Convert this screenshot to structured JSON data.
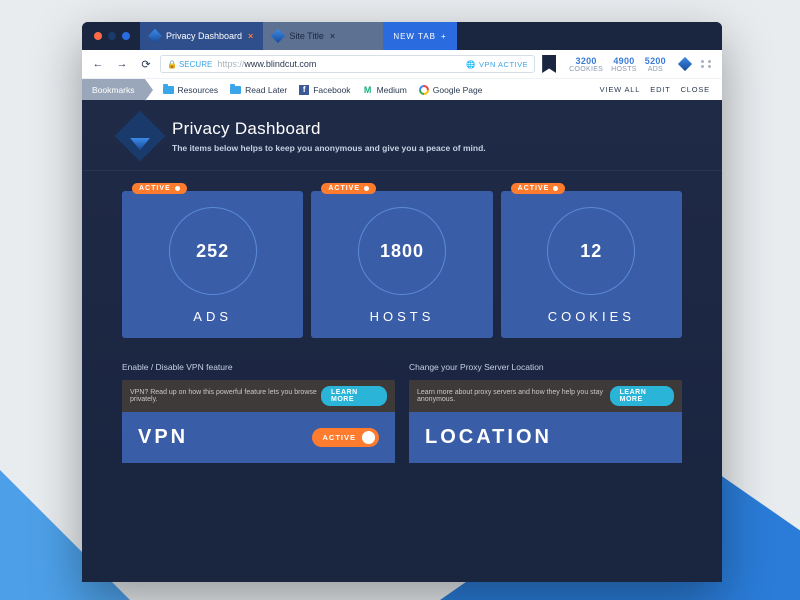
{
  "tabs": {
    "active": {
      "label": "Privacy Dashboard"
    },
    "inactive": {
      "label": "Site Title"
    },
    "newtab": "NEW TAB"
  },
  "addr": {
    "secure": "SECURE",
    "prefix": "https://",
    "domain": "www.blindcut.com",
    "vpn": "VPN ACTIVE"
  },
  "stats": {
    "cookies": {
      "n": "3200",
      "l": "COOKIES"
    },
    "hosts": {
      "n": "4900",
      "l": "HOSTS"
    },
    "ads": {
      "n": "5200",
      "l": "ADS"
    }
  },
  "bookmarks": {
    "label": "Bookmarks",
    "items": [
      "Resources",
      "Read Later",
      "Facebook",
      "Medium",
      "Google Page"
    ],
    "actions": [
      "VIEW ALL",
      "EDIT",
      "CLOSE"
    ]
  },
  "page": {
    "title": "Privacy Dashboard",
    "subtitle": "The items below helps to keep you anonymous and give you a peace of mind."
  },
  "cards": {
    "badge": "ACTIVE",
    "ads": {
      "n": "252",
      "l": "ADS"
    },
    "hosts": {
      "n": "1800",
      "l": "HOSTS"
    },
    "cookies": {
      "n": "12",
      "l": "COOKIES"
    }
  },
  "features": {
    "vpn": {
      "caption": "Enable / Disable VPN feature",
      "bar": "VPN? Read up on how this powerful feature lets you browse privately.",
      "learn": "LEARN MORE",
      "title": "VPN",
      "toggle": "ACTIVE"
    },
    "location": {
      "caption": "Change your Proxy Server Location",
      "bar": "Learn more about proxy servers and how they help you stay anonymous.",
      "learn": "LEARN MORE",
      "title": "LOCATION"
    }
  }
}
